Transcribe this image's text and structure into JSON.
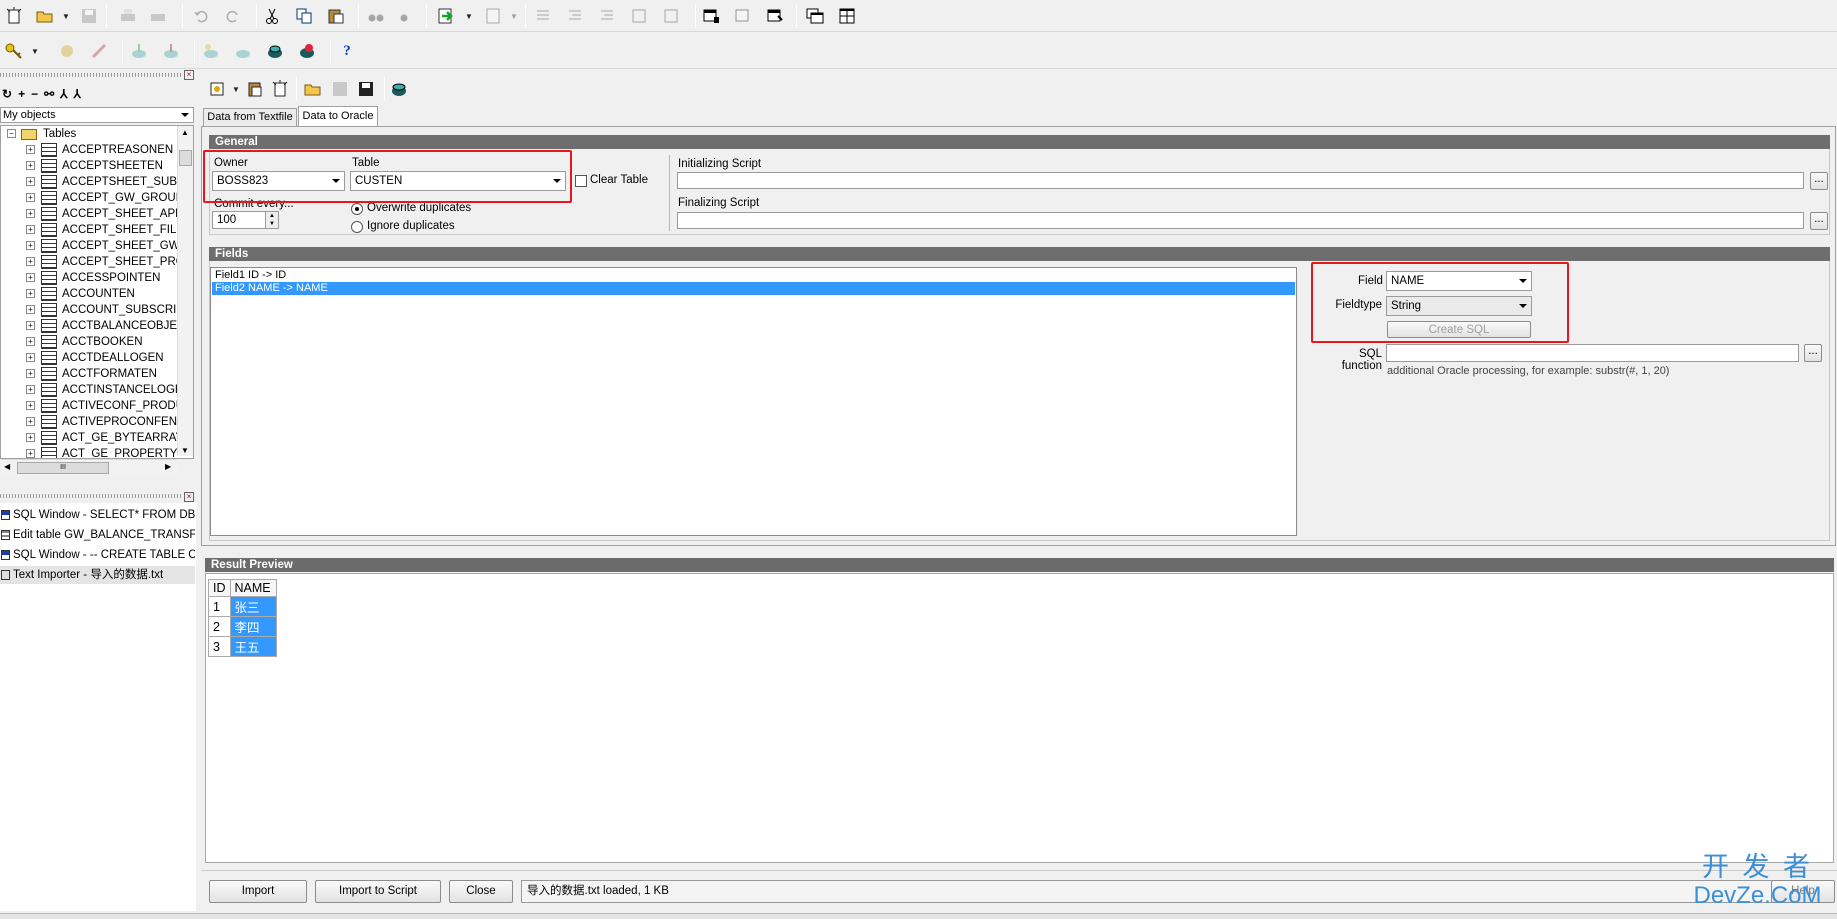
{
  "toolbar": {
    "row1_icons": [
      "new-icon",
      "open-icon",
      "save-icon",
      "print-icon",
      "print-preview-icon",
      "undo-icon",
      "redo-icon",
      "cut-icon",
      "copy-icon",
      "paste-icon",
      "find-icon",
      "replace-icon",
      "execute-icon",
      "export-icon",
      "indent-icon",
      "unindent-icon",
      "comment-icon",
      "uncomment-icon",
      "upper-icon",
      "lower-icon",
      "window-list-icon",
      "tile-icon",
      "cascade-icon",
      "new-window-icon",
      "windows-icon"
    ],
    "row2_icons": [
      "key-icon",
      "debug-icon",
      "stop-icon",
      "commit-icon",
      "rollback-icon",
      "sql-icon",
      "explain-icon",
      "session-icon",
      "database-icon",
      "help-icon"
    ]
  },
  "object_browser": {
    "filter": "My objects",
    "root": "Tables",
    "tables": [
      "ACCEPTREASONEN",
      "ACCEPTSHEETEN",
      "ACCEPTSHEET_SUBSC",
      "ACCEPT_GW_GROUP_",
      "ACCEPT_SHEET_APPC",
      "ACCEPT_SHEET_FILE_",
      "ACCEPT_SHEET_GW_",
      "ACCEPT_SHEET_PROI",
      "ACCESSPOINTEN",
      "ACCOUNTEN",
      "ACCOUNT_SUBSCRIBE",
      "ACCTBALANCEOBJEN",
      "ACCTBOOKEN",
      "ACCTDEALLOGEN",
      "ACCTFORMATEN",
      "ACCTINSTANCELOGEN",
      "ACTIVECONF_PRODUC",
      "ACTIVEPROCONFEN",
      "ACT_GE_BYTEARRAY",
      "ACT_GE_PROPERTY"
    ],
    "hscroll_label": "III"
  },
  "window_list": [
    {
      "label": "SQL Window - SELECT* FROM DBTE",
      "icon": "sql-window-icon"
    },
    {
      "label": "Edit table GW_BALANCE_TRANSFER",
      "icon": "edit-table-icon"
    },
    {
      "label": "SQL Window - -- CREATE TABLE CRI",
      "icon": "sql-window-icon"
    },
    {
      "label": "Text Importer - 导入的数据.txt",
      "icon": "importer-icon"
    }
  ],
  "importer": {
    "tabs": [
      "Data from Textfile",
      "Data to Oracle"
    ],
    "active_tab": 1,
    "general": {
      "header": "General",
      "owner_label": "Owner",
      "owner_value": "BOSS823",
      "table_label": "Table",
      "table_value": "CUSTEN",
      "clear_table_label": "Clear Table",
      "commit_label": "Commit every...",
      "commit_value": "100",
      "overwrite_label": "Overwrite duplicates",
      "ignore_label": "Ignore duplicates",
      "init_script_label": "Initializing Script",
      "final_script_label": "Finalizing Script",
      "ellipsis": "..."
    },
    "fields": {
      "header": "Fields",
      "items": [
        "Field1  ID  ->  ID",
        "Field2  NAME  ->  NAME"
      ],
      "selected_index": 1,
      "field_label": "Field",
      "field_value": "NAME",
      "fieldtype_label": "Fieldtype",
      "fieldtype_value": "String",
      "create_sql_label": "Create SQL",
      "sql_function_label": "SQL function",
      "sql_hint": "additional Oracle processing, for example: substr(#, 1, 20)"
    },
    "preview": {
      "header": "Result Preview",
      "columns": [
        "ID",
        "NAME"
      ],
      "rows": [
        [
          "1",
          "张三"
        ],
        [
          "2",
          "李四"
        ],
        [
          "3",
          "王五"
        ]
      ]
    },
    "buttons": {
      "import": "Import",
      "import_script": "Import to Script",
      "close": "Close",
      "help": "Help"
    },
    "status": "导入的数据.txt loaded,  1 KB"
  },
  "watermark": {
    "line1": "开 发 者",
    "line2": "DevZe.CoM"
  },
  "colors": {
    "highlight": "#3399ff",
    "annotation": "#e8171f",
    "header": "#6e6e6e",
    "watermark": "#3b8fd6"
  }
}
